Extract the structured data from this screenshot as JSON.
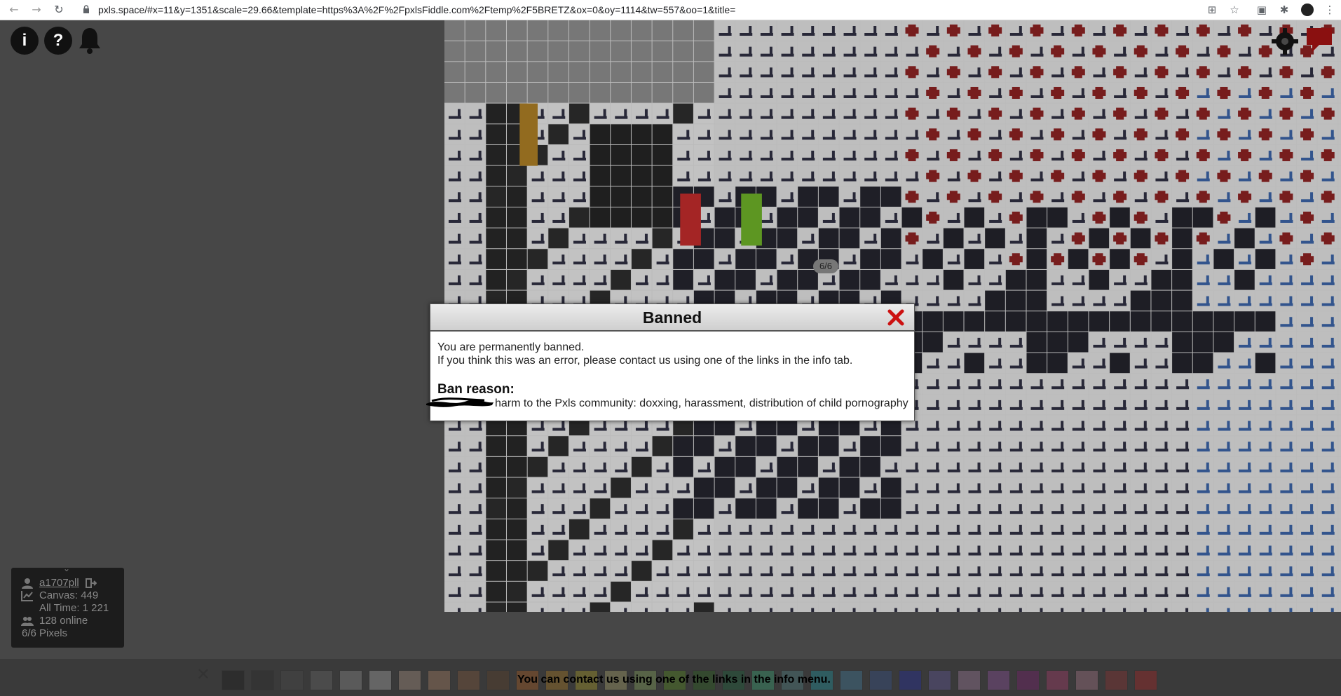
{
  "browser": {
    "url": "pxls.space/#x=11&y=1351&scale=29.66&template=https%3A%2F%2FpxlsFiddle.com%2Ftemp%2F5BRETZ&ox=0&oy=1114&tw=557&oo=1&title="
  },
  "top_icons": [
    "info-icon",
    "help-icon",
    "bell-icon"
  ],
  "modal": {
    "title": "Banned",
    "line1": "You are permanently banned.",
    "line2": "If you think this was an error, please contact us using one of the links in the info tab.",
    "reason_label": "Ban reason:",
    "reason_text": "harm to the Pxls community: doxxing, harassment, distribution of child pornography"
  },
  "cursor_bubble": "6/6",
  "info_panel": {
    "username": "a1707pll",
    "canvas": "Canvas: 449",
    "all_time": "All Time: 1 221",
    "online": "128 online",
    "pixels": "6/6 Pixels"
  },
  "palette": {
    "message": "You can contact us using one of the links in the info menu.",
    "colors": [
      "#000000",
      "#222222",
      "#555555",
      "#888888",
      "#cdcdcd",
      "#ffffff",
      "#ffd5bc",
      "#ffb783",
      "#b66d3d",
      "#77431f",
      "#fc7510",
      "#fca80e",
      "#fde817",
      "#fff491",
      "#bef678",
      "#6ac40a",
      "#237e09",
      "#067f3e",
      "#36ee9d",
      "#5fb5ba",
      "#0ad5e8",
      "#43ade7",
      "#3266c7",
      "#1020ed",
      "#7e6ce4",
      "#eaace9",
      "#cd5ee7",
      "#a70d96",
      "#ff3b90",
      "#f9a4c1",
      "#cb2a2a",
      "#ff1515"
    ]
  },
  "colors": {
    "modal_close": "#cc1111",
    "background": "#474747"
  }
}
